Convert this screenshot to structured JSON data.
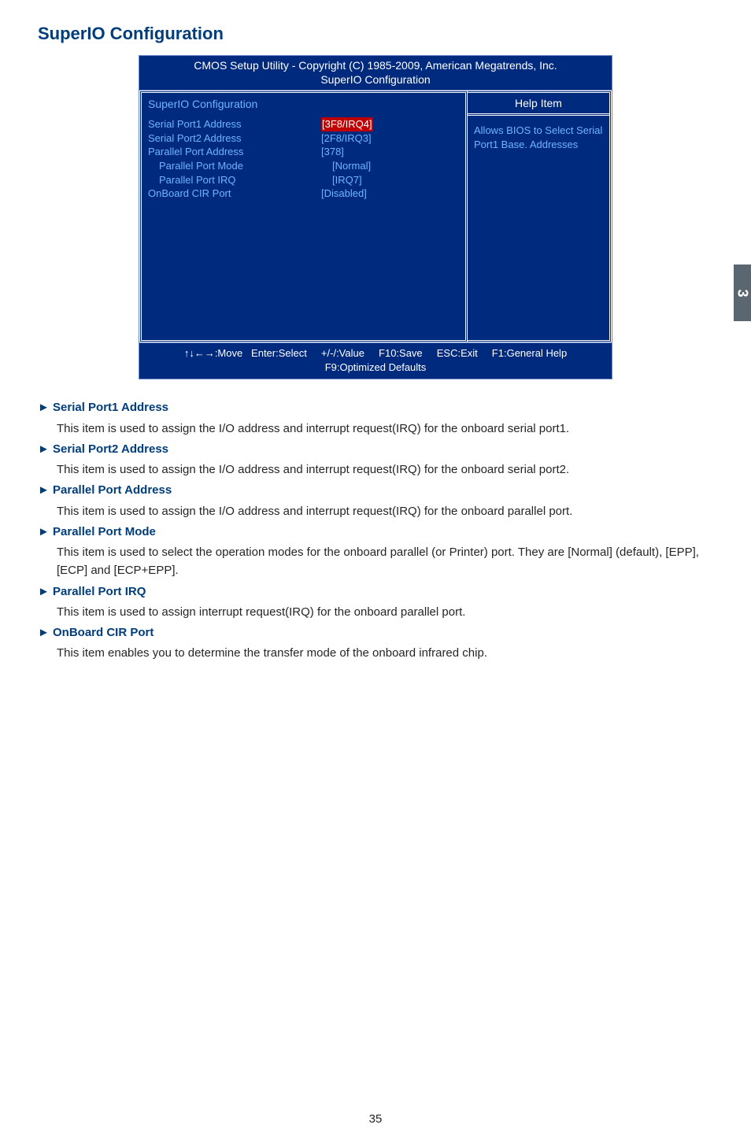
{
  "title": "SuperIO Configuration",
  "bios": {
    "header_line1": "CMOS Setup Utility - Copyright (C) 1985-2009, American Megatrends, Inc.",
    "header_line2": "SuperIO Configuration",
    "section_title": "SuperIO Configuration",
    "rows": [
      {
        "label": "Serial Port1 Address",
        "value": "[3F8/IRQ4]",
        "selected": true,
        "indent": false
      },
      {
        "label": "Serial Port2 Address",
        "value": "[2F8/IRQ3]",
        "selected": false,
        "indent": false
      },
      {
        "label": "Parallel Port Address",
        "value": "[378]",
        "selected": false,
        "indent": false
      },
      {
        "label": "Parallel Port Mode",
        "value": "[Normal]",
        "selected": false,
        "indent": true
      },
      {
        "label": "Parallel Port IRQ",
        "value": "[IRQ7]",
        "selected": false,
        "indent": true
      },
      {
        "label": "OnBoard CIR Port",
        "value": "[Disabled]",
        "selected": false,
        "indent": false
      }
    ],
    "help_header": "Help Item",
    "help_text": "Allows BIOS to Select Serial Port1 Base. Addresses",
    "footer_line1": "↑↓←→:Move   Enter:Select     +/-/:Value     F10:Save     ESC:Exit     F1:General Help",
    "footer_line2": "F9:Optimized Defaults"
  },
  "side_tab": "3",
  "descriptions": [
    {
      "heading": "► Serial Port1 Address",
      "text": "This item is used to assign the I/O address and interrupt request(IRQ) for the onboard serial port1."
    },
    {
      "heading": "► Serial Port2 Address",
      "text": "This item is used to assign the I/O address and interrupt request(IRQ) for the onboard serial port2."
    },
    {
      "heading": "► Parallel Port Address",
      "text": "This item is used to assign the I/O address and interrupt request(IRQ) for the onboard parallel port."
    },
    {
      "heading": "► Parallel Port Mode",
      "text": "This item is used to select the operation modes for the onboard parallel (or Printer) port. They are [Normal] (default), [EPP], [ECP] and [ECP+EPP]."
    },
    {
      "heading": "► Parallel Port IRQ",
      "text": "This item is used to assign interrupt request(IRQ) for the onboard parallel port."
    },
    {
      "heading": "► OnBoard CIR Port",
      "text": "This item enables you to determine the transfer mode of the onboard infrared chip."
    }
  ],
  "page_number": "35"
}
